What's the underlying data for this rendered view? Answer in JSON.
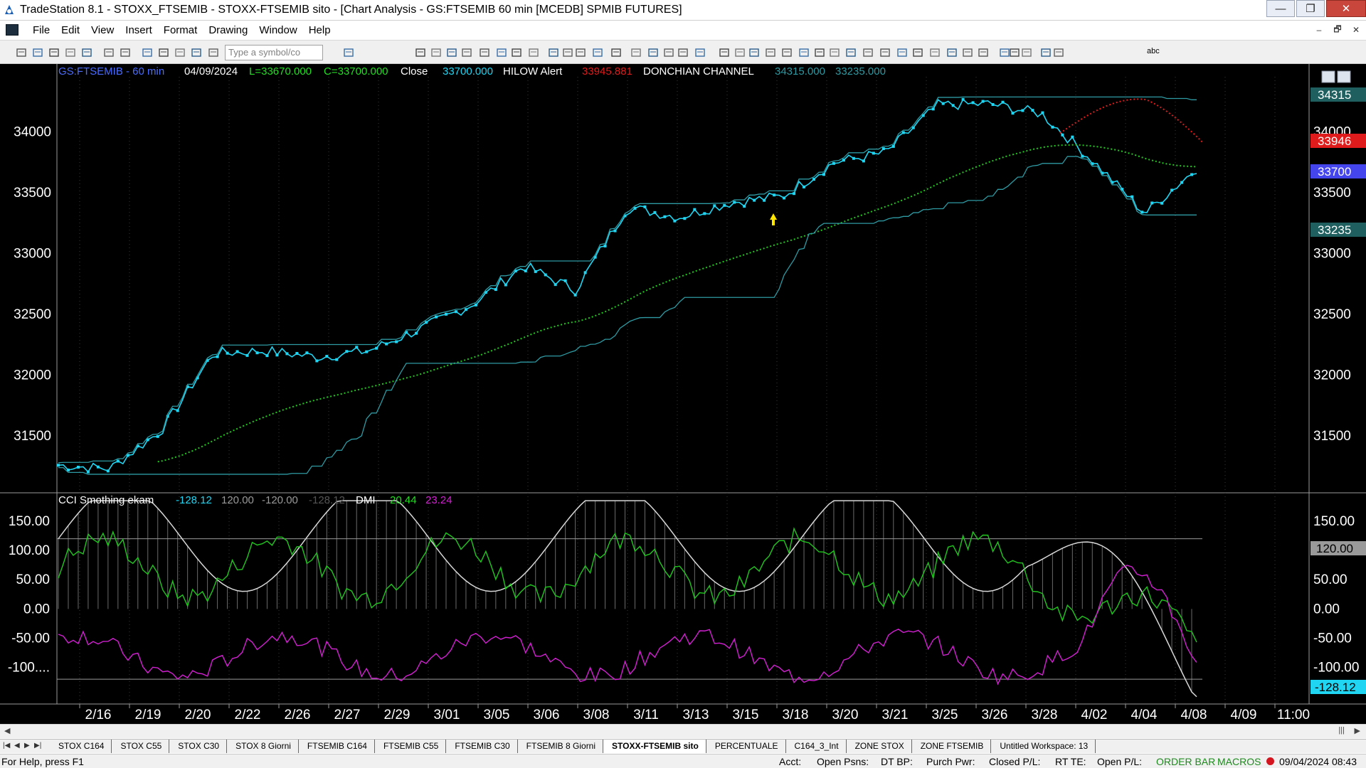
{
  "window": {
    "title": "TradeStation 8.1 - STOXX_FTSEMIB - STOXX-FTSEMIB sito - [Chart Analysis - GS:FTSEMIB  60 min  [MCEDB] SPMIB FUTURES]",
    "minimize_label": "—",
    "maximize_label": "❐",
    "close_label": "✕"
  },
  "menu": {
    "items": [
      "File",
      "Edit",
      "View",
      "Insert",
      "Format",
      "Drawing",
      "Window",
      "Help"
    ],
    "mdi_buttons": [
      "–",
      "🗗",
      "✕"
    ]
  },
  "toolbar": {
    "symbol_placeholder": "Type a symbol/co",
    "icons": [
      "new-icon",
      "open-icon",
      "copy-window-icon",
      "new-workspace-icon",
      "open-folder-icon",
      "save-icon",
      "print-preview-icon",
      "print-icon",
      "desktop-icon",
      "lock-icon",
      "drawing-icon",
      "globe-icon",
      "symbol-dropdown-icon",
      "send-icon",
      "search-icon",
      "chart-icon",
      "radar-icon",
      "grid-icon",
      "tool-icon",
      "indicator-icon",
      "strategy-icon",
      "format-icon",
      "zoom-in-icon",
      "zoom-out-icon",
      "cursor-icon",
      "hand-icon",
      "draw-tool-icon",
      "trendline-icon",
      "horizontal-line-icon",
      "vertical-line-icon",
      "fib-icon",
      "arrow-up-icon",
      "arrow-down-icon",
      "circle-icon",
      "rectangle-icon",
      "text-icon"
    ],
    "text_tool_label": "abc"
  },
  "chart": {
    "header": {
      "symbol": "GS:FTSEMIB - 60 min",
      "date": "04/09/2024",
      "low": "L=33670.000",
      "close": "C=33700.000",
      "close_label": "Close",
      "close_value": "33700.000",
      "hilow_label": "HILOW Alert",
      "hilow_value": "33945.881",
      "donchian_label": "DONCHIAN CHANNEL",
      "donchian_upper": "34315.000",
      "donchian_lower": "33235.000"
    },
    "sub_header": {
      "label": "CCI Smothing ekam",
      "cci": "-128.12",
      "upper_level": "120.00",
      "lower_level": "-120.00",
      "cci2": "-128.12",
      "dmi_label": "DMI",
      "dmi_plus": "20.44",
      "dmi_minus": "23.24"
    },
    "price_axis_ticks": [
      "34000",
      "33500",
      "33000",
      "32500",
      "32000",
      "31500"
    ],
    "price_right_ticks": [
      "34000",
      "33500",
      "33000",
      "32500",
      "32000",
      "31500"
    ],
    "osc_axis_ticks": [
      "150.00",
      "100.00",
      "50.00",
      "0.00",
      "-50.00",
      "-100...."
    ],
    "osc_right_ticks": [
      "150.00",
      "100.00",
      "50.00",
      "0.00",
      "-50.00",
      "-100.00"
    ],
    "badges": {
      "upper": "34315",
      "hilow": "33946",
      "close": "33700",
      "lower": "33235",
      "level": "120.00",
      "cci": "-128.12"
    },
    "date_labels": [
      "2/16",
      "2/19",
      "2/20",
      "2/22",
      "2/26",
      "2/27",
      "2/29",
      "3/01",
      "3/05",
      "3/06",
      "3/08",
      "3/11",
      "3/13",
      "3/15",
      "3/18",
      "3/20",
      "3/21",
      "3/25",
      "3/26",
      "3/28",
      "4/02",
      "4/04",
      "4/08",
      "4/09",
      "11:00"
    ],
    "colors": {
      "price": "#1fd5f2",
      "ma": "#22c71f",
      "donchian": "#2e9aa3",
      "hilow": "#e01b1b",
      "cci_white": "#d8d8d8",
      "dmi_plus": "#21c61f",
      "dmi_minus": "#d21fd2"
    }
  },
  "chart_data": {
    "type": "line",
    "price_series": {
      "name": "GS:FTSEMIB - 60 min",
      "x": [
        "2/16",
        "2/19",
        "2/20",
        "2/22",
        "2/26",
        "2/27",
        "2/29",
        "3/01",
        "3/05",
        "3/06",
        "3/08",
        "3/11",
        "3/13",
        "3/15",
        "3/18",
        "3/20",
        "3/21",
        "3/25",
        "3/26",
        "3/28",
        "4/02",
        "4/04",
        "4/08"
      ],
      "close": [
        31260,
        31230,
        31550,
        32180,
        32200,
        32150,
        32200,
        32380,
        32580,
        32900,
        32700,
        33380,
        33300,
        33420,
        33470,
        33750,
        33830,
        34220,
        34230,
        34150,
        33760,
        33330,
        33700
      ]
    },
    "ylim": [
      31050,
      34500
    ],
    "osc_ylim": [
      -160,
      190
    ],
    "levels": [
      120,
      -120
    ]
  },
  "tabs": {
    "items": [
      "STOX C164",
      "STOX C55",
      "STOX  C30",
      "STOX  8 Giorni",
      "FTSEMIB C164",
      "FTSEMIB C55",
      "FTSEMIB C30",
      "FTSEMIB  8 Giorni",
      "STOXX-FTSEMIB sito",
      "PERCENTUALE",
      "C164_3_Int",
      "ZONE STOX",
      "ZONE FTSEMIB",
      "Untitled Workspace:  13"
    ],
    "active_index": 8
  },
  "status": {
    "help": "For Help, press F1",
    "acct": "Acct:",
    "open_psns": "Open Psns:",
    "dt_bp": "DT BP:",
    "purch_pwr": "Purch Pwr:",
    "closed_pl": "Closed P/L:",
    "rt_te": "RT TE:",
    "open_pl": "Open P/L:",
    "order_bar": "ORDER BAR",
    "macros": "MACROS",
    "datetime": "09/04/2024 08:43"
  }
}
